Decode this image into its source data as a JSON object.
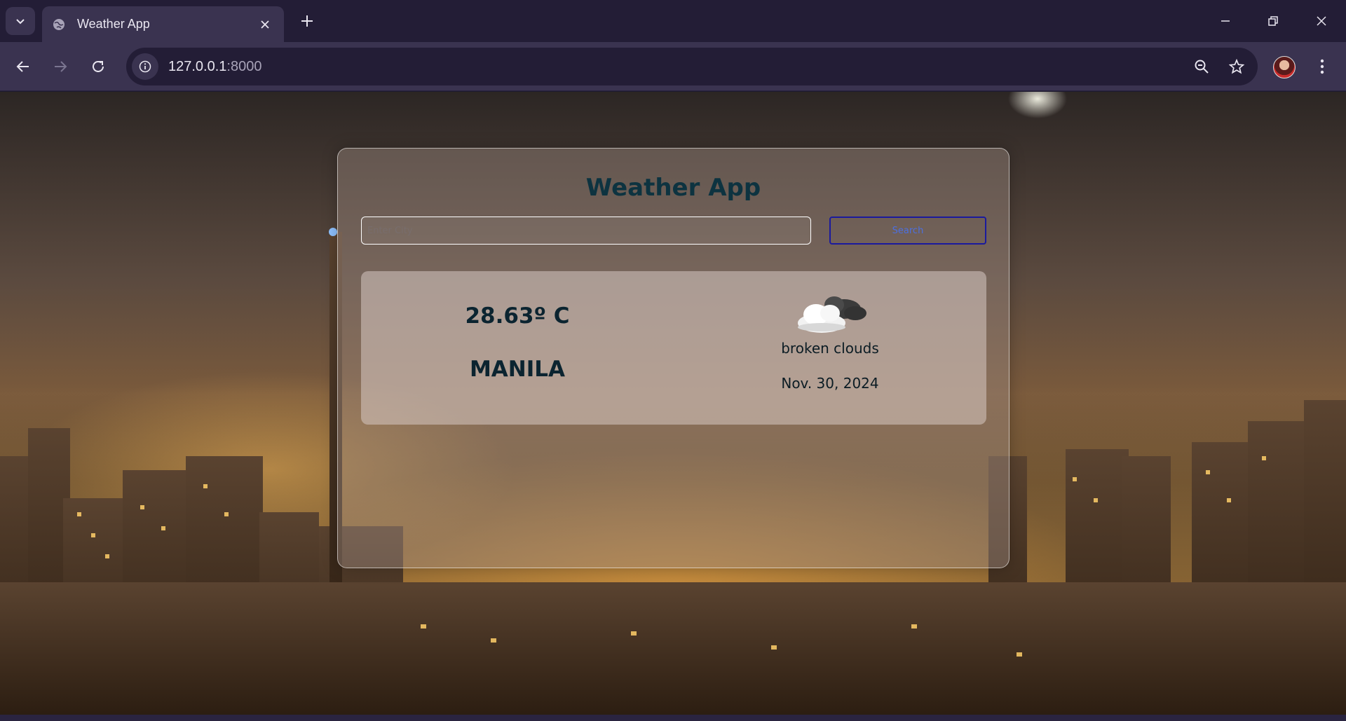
{
  "browser": {
    "tab_title": "Weather App",
    "url_host": "127.0.0.1",
    "url_port": ":8000"
  },
  "app": {
    "title": "Weather App",
    "search": {
      "placeholder": "Enter City",
      "value": "",
      "button_label": "Search"
    },
    "weather": {
      "temperature": "28.63º C",
      "city": "MANILA",
      "description": "broken clouds",
      "date": "Nov. 30, 2024",
      "icon": "broken-clouds-icon"
    }
  },
  "colors": {
    "title": "#0d3340",
    "button_border": "#1a1a9e",
    "button_text": "#4c6fe0",
    "chrome_dark": "#231d36",
    "chrome_mid": "#3a3350"
  }
}
